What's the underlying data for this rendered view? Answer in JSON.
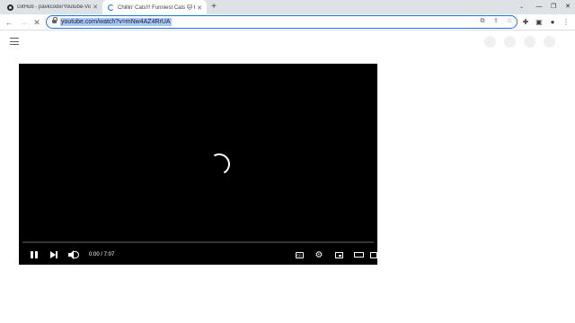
{
  "browser": {
    "tabs": [
      {
        "label": "GitHub - pavkcode/Youtube-Vid",
        "active": false
      },
      {
        "label": "Chillin' Cats!!! Funniest Cats 🐱 F",
        "active": true
      }
    ],
    "new_tab_symbol": "+",
    "address_bar": {
      "url": "youtube.com/watch?v=mNw4AZ4RrUA"
    },
    "window_controls": {
      "minimize": "—",
      "restore": "❐",
      "close": "✕"
    },
    "tab_search_symbol": "⌄"
  },
  "player": {
    "current_time": "0:00",
    "duration": "7:07",
    "time_display": "0:00 / 7:07",
    "progress": 0,
    "cc_label": "CC",
    "loading": true
  },
  "colors": {
    "accent": "#1a73e8",
    "url_highlight": "#a8c7fa",
    "player_bg": "#000000",
    "tabstrip_bg": "#dee1e6"
  },
  "icons": [
    "github-icon",
    "loading-icon",
    "close-icon",
    "plus-icon",
    "back-icon",
    "forward-icon",
    "reload-icon",
    "lock-icon",
    "open-in-app-icon",
    "share-icon",
    "star-icon",
    "puzzle-icon",
    "side-panel-icon",
    "profile-icon",
    "more-icon",
    "hamburger-icon",
    "pause-icon",
    "next-icon",
    "volume-icon",
    "cc-icon",
    "gear-icon",
    "miniplayer-icon",
    "theater-icon",
    "fullscreen-icon"
  ]
}
